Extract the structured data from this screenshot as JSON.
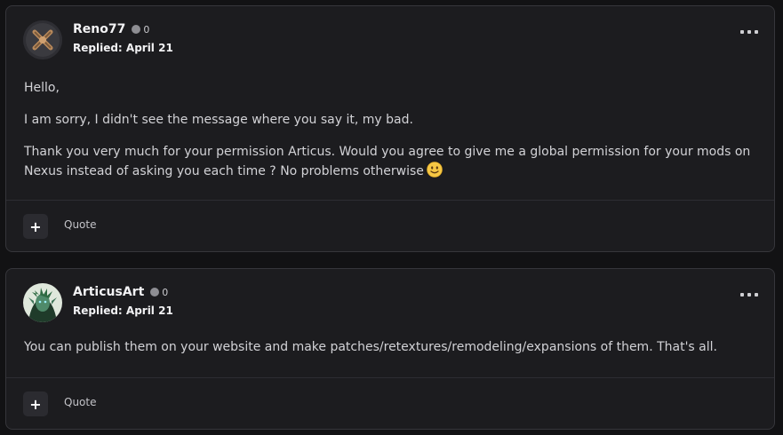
{
  "posts": [
    {
      "username": "Reno77",
      "reputation": "0",
      "replied": "Replied: April 21",
      "paragraphs": [
        "Hello,",
        "I am sorry, I didn't see the message where you say it, my bad.",
        "Thank you very much for your permission Articus. Would you agree to give me a global permission for your mods on Nexus instead of asking you each time ? No problems otherwise"
      ],
      "plus_label": "+",
      "quote_label": "Quote"
    },
    {
      "username": "ArticusArt",
      "reputation": "0",
      "replied": "Replied: April 21",
      "paragraphs": [
        "You can publish them on your website and make patches/retextures/remodeling/expansions of them. That's all."
      ],
      "plus_label": "+",
      "quote_label": "Quote"
    }
  ],
  "icons": {
    "smile": "slightly-smiling-face-emoji",
    "more": "more-dots-icon",
    "status": "status-dot-icon"
  },
  "colors": {
    "background": "#121214",
    "card": "#1c1c1f",
    "border": "#36363b",
    "text": "#d2d2d6"
  }
}
